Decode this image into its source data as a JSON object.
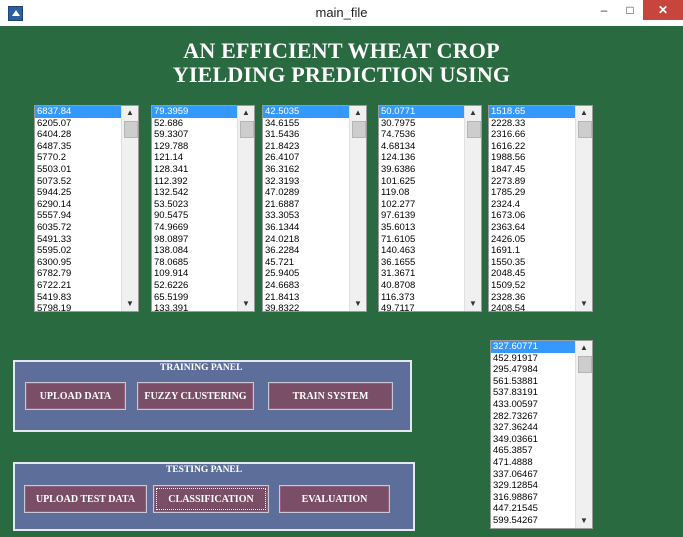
{
  "window": {
    "title": "main_file",
    "minimize": "–",
    "maximize": "□",
    "close": "✕"
  },
  "heading": {
    "line1": "AN EFFICIENT WHEAT CROP",
    "line2": "YIELDING PREDICTION USING"
  },
  "lists": [
    {
      "items": [
        "6837.84",
        "6205.07",
        "6404.28",
        "6487.35",
        "5770.2",
        "5503.01",
        "5073.52",
        "5944.25",
        "6290.14",
        "5557.94",
        "6035.72",
        "5491.33",
        "5595.02",
        "6300.95",
        "6782.79",
        "6722.21",
        "5419.83",
        "5798.19"
      ]
    },
    {
      "items": [
        "79.3959",
        "52.686",
        "59.3307",
        "129.788",
        "121.14",
        "128.341",
        "112.392",
        "132.542",
        "53.5023",
        "90.5475",
        "74.9669",
        "98.0897",
        "138.084",
        "78.0685",
        "109.914",
        "52.6226",
        "65.5199",
        "133.391"
      ]
    },
    {
      "items": [
        "42.5035",
        "34.6155",
        "31.5436",
        "21.8423",
        "26.4107",
        "36.3162",
        "32.3193",
        "47.0289",
        "21.6887",
        "33.3053",
        "36.1344",
        "24.0218",
        "36.2284",
        "45.721",
        "25.9405",
        "24.6683",
        "21.8413",
        "39.8322"
      ]
    },
    {
      "items": [
        "50.0771",
        "30.7975",
        "74.7536",
        "4.68134",
        "124.136",
        "39.6386",
        "101.625",
        "119.08",
        "102.277",
        "97.6139",
        "35.6013",
        "71.6105",
        "140.463",
        "36.1655",
        "31.3671",
        "40.8708",
        "116.373",
        "49.7117"
      ]
    },
    {
      "items": [
        "1518.65",
        "2228.33",
        "2316.66",
        "1616.22",
        "1988.56",
        "1847.45",
        "2273.89",
        "1785.29",
        "2324.4",
        "1673.06",
        "2363.64",
        "2426.05",
        "1691.1",
        "1550.35",
        "2048.45",
        "1509.52",
        "2328.36",
        "2408.54"
      ]
    }
  ],
  "result_list": {
    "items": [
      "327.60771",
      "452.91917",
      "295.47984",
      "561.53881",
      "537.83191",
      "433.00597",
      "282.73267",
      "327.36244",
      "349.03661",
      "465.3857",
      "471.4888",
      "337.06467",
      "329.12854",
      "316.98867",
      "447.21545",
      "599.54267"
    ]
  },
  "training_panel": {
    "title": "TRAINING PANEL",
    "upload_data": "UPLOAD DATA",
    "fuzzy_clustering": "FUZZY CLUSTERING",
    "train_system": "TRAIN SYSTEM"
  },
  "testing_panel": {
    "title": "TESTING PANEL",
    "upload_test_data": "UPLOAD TEST DATA",
    "classification": "CLASSIFICATION",
    "evaluation": "EVALUATION"
  },
  "colors": {
    "background": "#2a6a41",
    "panel": "#5e6e9a",
    "button": "#7a4e67",
    "selection": "#3399ff",
    "close_button": "#c7453d"
  }
}
